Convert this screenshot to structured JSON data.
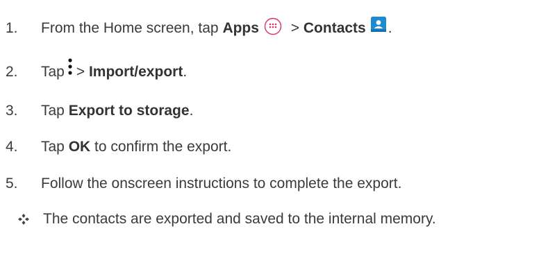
{
  "steps": [
    {
      "num": "1.",
      "pre": "From the Home screen, tap ",
      "bold1": "Apps",
      "mid": " > ",
      "bold2": "Contacts",
      "post": "."
    },
    {
      "num": "2.",
      "pre": "Tap",
      "mid": "> ",
      "bold": "Import/export",
      "post": "."
    },
    {
      "num": "3.",
      "pre": "Tap ",
      "bold": "Export to storage",
      "post": "."
    },
    {
      "num": "4.",
      "pre": "Tap ",
      "bold": "OK",
      "post": " to confirm the export."
    },
    {
      "num": "5.",
      "text": "Follow the onscreen instructions to complete the export."
    }
  ],
  "note": {
    "text": "The contacts are exported and saved to the internal memory."
  },
  "icons": {
    "apps": "apps-icon",
    "contacts": "contacts-icon",
    "menu": "menu-dots-icon",
    "bullet": "diamond-bullet-icon"
  },
  "colors": {
    "text": "#3a3a3a",
    "apps_icon": "#d6336c",
    "contacts_icon": "#1e8bd0"
  }
}
